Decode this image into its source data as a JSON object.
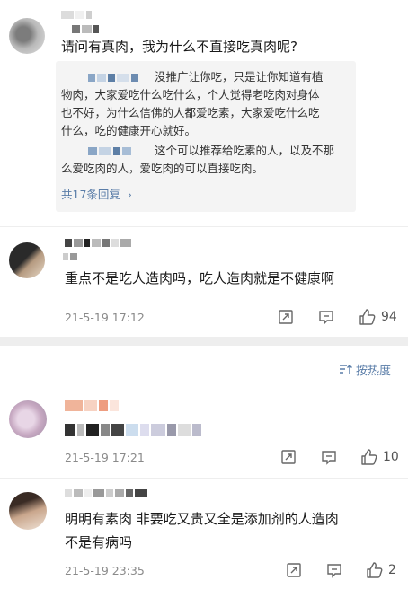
{
  "post1": {
    "question": "请问有真肉，我为什么不直接吃真肉呢?",
    "reply1_lines": [
      "没推广让你吃，只是让你知道有植",
      "物肉，大家爱吃什么吃什么，个人觉得老吃肉对身体",
      "也不好，为什么信佛的人都爱吃素，大家爱吃什么吃",
      "什么，吃的健康开心就好。"
    ],
    "reply2_lines": [
      "这个可以推荐给吃素的人，以及不那",
      "么爱吃肉的人，爱吃肉的可以直接吃肉。"
    ],
    "reply_count_link": "共17条回复"
  },
  "comment1": {
    "text": "重点不是吃人造肉吗，吃人造肉就是不健康啊",
    "time": "21-5-19 17:12",
    "likes": "94"
  },
  "sort": {
    "label": "按热度"
  },
  "comment2": {
    "time": "21-5-19 17:21",
    "likes": "10"
  },
  "comment3": {
    "text_lines": [
      "明明有素肉 非要吃又贵又全是添加剂的人造肉",
      "不是有病吗"
    ],
    "time": "21-5-19 23:35",
    "likes": "2"
  },
  "icons": [
    "share-icon",
    "comment-icon",
    "like-icon",
    "chevron-right-icon",
    "sort-icon"
  ],
  "colors": {
    "link": "#5a7da8",
    "reply_bg": "#f4f4f4",
    "divider": "#eeeeee"
  }
}
